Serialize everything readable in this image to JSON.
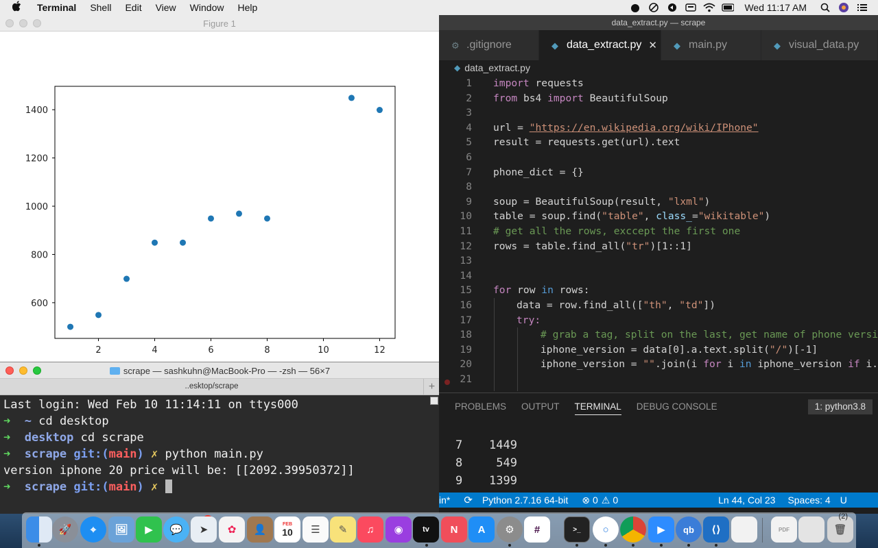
{
  "menubar": {
    "app_name": "Terminal",
    "menus": [
      "Shell",
      "Edit",
      "View",
      "Window",
      "Help"
    ],
    "clock": "Wed 11:17 AM"
  },
  "figure": {
    "title": "Figure 1"
  },
  "chart_data": {
    "type": "scatter",
    "x": [
      1,
      2,
      3,
      4,
      5,
      6,
      7,
      8,
      11,
      12
    ],
    "y": [
      500,
      549,
      699,
      849,
      849,
      949,
      969,
      949,
      1449,
      1399
    ],
    "xticks": [
      2,
      4,
      6,
      8,
      10,
      12
    ],
    "yticks": [
      600,
      800,
      1000,
      1200,
      1400
    ],
    "xlim": [
      0.45,
      12.55
    ],
    "ylim": [
      452,
      1497
    ],
    "grid": false,
    "color": "#1f77b4",
    "title": "",
    "xlabel": "",
    "ylabel": ""
  },
  "terminal": {
    "title": "scrape — sashkuhn@MacBook-Pro — -zsh — 56×7",
    "tab_label": "..esktop/scrape",
    "last_login": "Last login: Wed Feb 10 11:14:11 on ttys000",
    "prompt_arrow": "➜",
    "home_dir": "~",
    "cmd1": "cd desktop",
    "dir_desktop": "desktop",
    "cmd2": "cd scrape",
    "dir_scrape": "scrape",
    "git_prefix": "git:(",
    "branch": "main",
    "git_suffix": ")",
    "dirty_mark": "✗",
    "cmd3": "python main.py",
    "output": "version iphone 20 price will be: [[2092.39950372]]"
  },
  "vscode": {
    "window_title": "data_extract.py — scrape",
    "tabs": [
      {
        "label": ".gitignore"
      },
      {
        "label": "data_extract.py"
      },
      {
        "label": "main.py"
      },
      {
        "label": "visual_data.py"
      }
    ],
    "breadcrumb": "data_extract.py",
    "line_numbers": [
      "1",
      "2",
      "3",
      "4",
      "5",
      "6",
      "7",
      "8",
      "9",
      "10",
      "11",
      "12",
      "13",
      "14",
      "15",
      "16",
      "17",
      "18",
      "19",
      "20",
      "21"
    ],
    "code": {
      "import": "import",
      "requests": " requests",
      "from": "from",
      "bs4": " bs4 ",
      "BeautifulSoup": " BeautifulSoup",
      "url_assign": "url = ",
      "url_value": "\"https://en.wikipedia.org/wiki/IPhone\"",
      "result_line": "result = requests.get(url).text",
      "dict_line": "phone_dict = {}",
      "soup_a": "soup = BeautifulSoup(result, ",
      "soup_str": "\"lxml\"",
      "soup_b": ")",
      "table_a": "table = soup.find(",
      "table_str1": "\"table\"",
      "table_b": ", ",
      "table_param": "class_",
      "table_c": "=",
      "table_str2": "\"wikitable\"",
      "table_d": ")",
      "comment1": "# get all the rows, exccept the first one",
      "rows_a": "rows = table.find_all(",
      "rows_str": "\"tr\"",
      "rows_b": ")[1::1]",
      "for": "for",
      "row_in": " row ",
      "in": "in",
      "rows_colon": " rows:",
      "data_a": "data = row.find_all([",
      "data_str1": "\"th\"",
      "data_b": ", ",
      "data_str2": "\"td\"",
      "data_c": "])",
      "try": "try:",
      "comment2": "# grab a tag, split on the last, get name of phone versio",
      "iv1_a": "iphone_version = data[0].a.text.split(",
      "iv1_str": "\"/\"",
      "iv1_b": ")[-1]",
      "iv2_a": "iphone_version = ",
      "iv2_str": "\"\"",
      "iv2_b": ".join(i ",
      "iv2_for": "for",
      "iv2_c": " i ",
      "iv2_in": "in",
      "iv2_d": " iphone_version ",
      "iv2_if": "if",
      "iv2_e": " i.i"
    },
    "panel_tabs": [
      "PROBLEMS",
      "OUTPUT",
      "TERMINAL",
      "DEBUG CONSOLE"
    ],
    "panel_select": "1: python3.8",
    "panel_rows": [
      {
        "index": "7",
        "value": "1449"
      },
      {
        "index": "8",
        "value": "549"
      },
      {
        "index": "9",
        "value": "1399"
      }
    ],
    "status": {
      "left_cut": "in*",
      "python": "Python 2.7.16 64-bit",
      "errors": "0",
      "warnings": "0",
      "position": "Ln 44, Col 23",
      "spaces": "Spaces: 4",
      "encoding_cut": "U"
    }
  },
  "dock": {
    "badge": "28",
    "calendar_day": "10",
    "calendar_month": "FEB",
    "qb_label": "qb",
    "corner_text": "(2)"
  }
}
